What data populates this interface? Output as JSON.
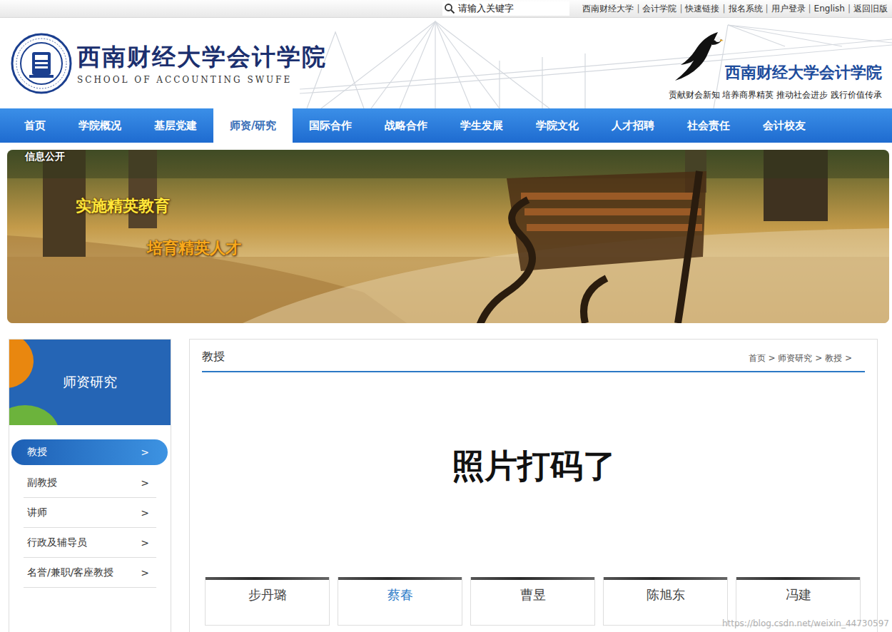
{
  "topbar": {
    "search": {
      "placeholder": "请输入关键字"
    },
    "links": [
      "西南财经大学",
      "会计学院",
      "快速链接",
      "报名系统",
      "用户登录",
      "English",
      "返回旧版"
    ],
    "separator": "|"
  },
  "header": {
    "logo_title": "西南财经大学会计学院",
    "logo_subtitle": "SCHOOL OF ACCOUNTING SWUFE",
    "brand_title": "西南财经大学会计学院",
    "slogan": "贡献财会新知 培养商界精英 推动社会进步 践行价值传承"
  },
  "nav": [
    {
      "label": "首页",
      "selected": false
    },
    {
      "label": "学院概况",
      "selected": false
    },
    {
      "label": "基层党建",
      "selected": false
    },
    {
      "label": "师资/研究",
      "selected": true
    },
    {
      "label": "国际合作",
      "selected": false
    },
    {
      "label": "战略合作",
      "selected": false
    },
    {
      "label": "学生发展",
      "selected": false
    },
    {
      "label": "学院文化",
      "selected": false
    },
    {
      "label": "人才招聘",
      "selected": false
    },
    {
      "label": "社会责任",
      "selected": false
    },
    {
      "label": "会计校友",
      "selected": false
    }
  ],
  "banner": {
    "overlay_link": "信息公开",
    "slogans": [
      "实施精英教育",
      "培育精英人才"
    ]
  },
  "sidebar": {
    "title": "师资研究",
    "chevron": ">",
    "items": [
      {
        "label": "教授",
        "selected": true
      },
      {
        "label": "副教授",
        "selected": false
      },
      {
        "label": "讲师",
        "selected": false
      },
      {
        "label": "行政及辅导员",
        "selected": false
      },
      {
        "label": "名誉/兼职/客座教授",
        "selected": false
      }
    ]
  },
  "content": {
    "title": "教授",
    "breadcrumb": "首页 > 师资研究 > 教授 >",
    "notice": "照片打码了",
    "people": [
      {
        "name": "步丹璐",
        "highlighted": false
      },
      {
        "name": "蔡春",
        "highlighted": true
      },
      {
        "name": "曹昱",
        "highlighted": false
      },
      {
        "name": "陈旭东",
        "highlighted": false
      },
      {
        "name": "冯建",
        "highlighted": false
      }
    ]
  },
  "watermark": "https://blog.csdn.net/weixin_44730597"
}
